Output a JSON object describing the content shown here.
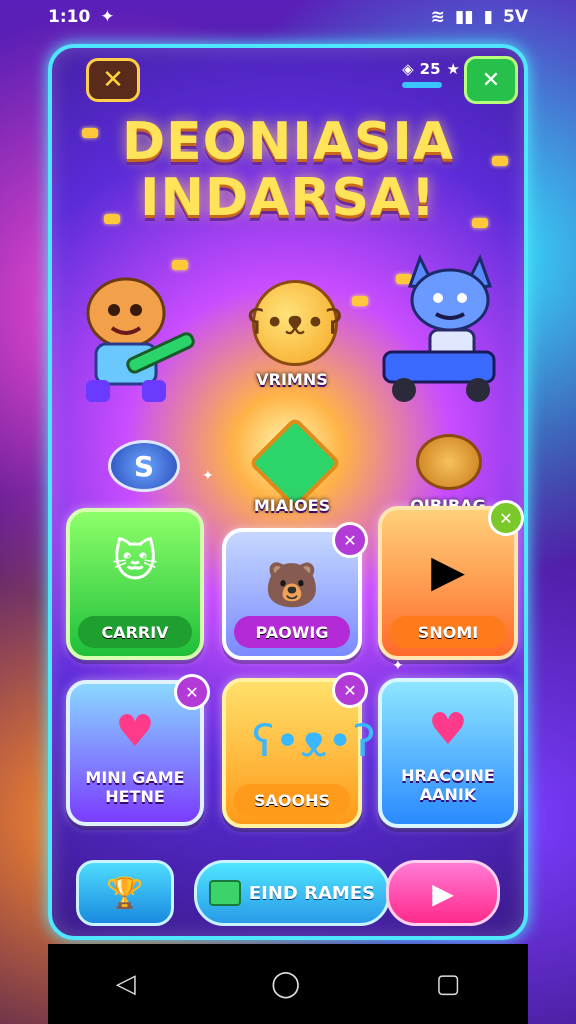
{
  "status": {
    "time": "1:10",
    "right_text": "5V",
    "icons": [
      "notification-icon",
      "wifi-icon",
      "signal-icon",
      "battery-icon"
    ]
  },
  "topbar": {
    "back_icon": "back-icon",
    "close_label": "✕",
    "currency_text": "25",
    "settings_label": "✕"
  },
  "title": {
    "line1": "DEONIASIA",
    "line2": "INDARSA!"
  },
  "center": {
    "label": "VRIMNS",
    "mid_left_label": "MIAIOES",
    "mid_right_label": "OIBIBAG"
  },
  "cards": [
    {
      "pill": "CARRIV"
    },
    {
      "pill": "PAOWIG",
      "badge": "✕"
    },
    {
      "pill": "SNOMI",
      "badge": "✕"
    },
    {
      "title": "MINI GAME\nHETNE",
      "badge": "✕"
    },
    {
      "pill": "SAOOHS",
      "badge": "✕"
    },
    {
      "title": "HRACOINE\nAANIK"
    }
  ],
  "bottom": {
    "find_label": "EIND RAMES",
    "play_label": "▶",
    "trophy_label": "🏆"
  },
  "nav": {
    "back": "◁",
    "home": "◯",
    "recent": "▢"
  },
  "colors": {
    "panel_border": "#4fe6ff",
    "title": "#ffe45a",
    "play": "#ff2a8a",
    "find": "#2a9ae8"
  }
}
